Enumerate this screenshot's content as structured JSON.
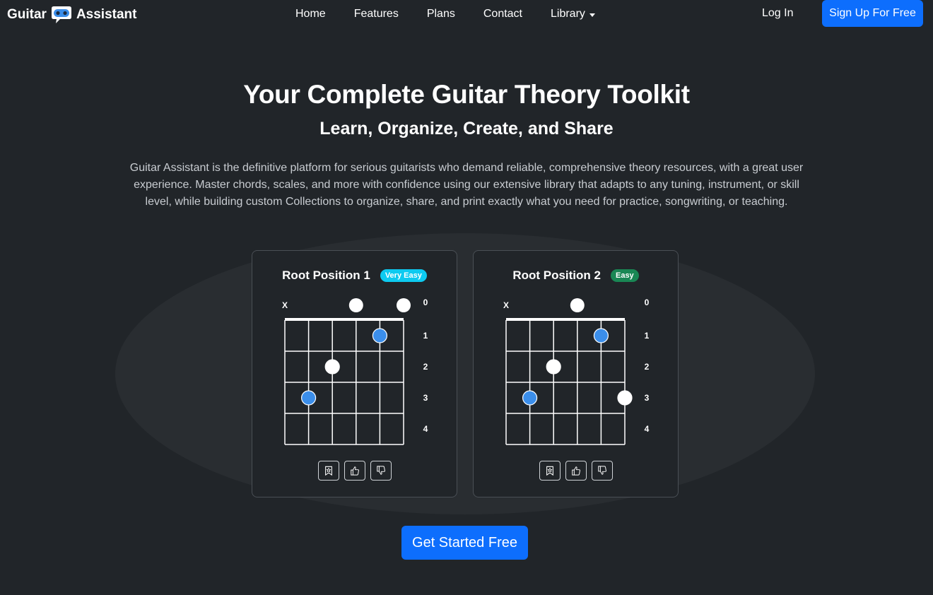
{
  "brand": {
    "word1": "Guitar",
    "word2": "Assistant",
    "logo_icon": "chat-bot-icon"
  },
  "nav": {
    "links": [
      "Home",
      "Features",
      "Plans",
      "Contact",
      "Library"
    ],
    "login": "Log In",
    "signup": "Sign Up For Free"
  },
  "hero": {
    "title": "Your Complete Guitar Theory Toolkit",
    "subtitle": "Learn, Organize, Create, and Share",
    "description": "Guitar Assistant is the definitive platform for serious guitarists who demand reliable, comprehensive theory resources, with a great user experience. Master chords, scales, and more with confidence using our extensive library that adapts to any tuning, instrument, or skill level, while building custom Collections to organize, share, and print exactly what you need for practice, songwriting, or teaching."
  },
  "colors": {
    "primary": "#0d6efd",
    "background": "#212529",
    "root_note": "#3b8eea",
    "badge_very_easy": "#0dcaf0",
    "badge_easy": "#198754"
  },
  "cards": [
    {
      "title": "Root Position 1",
      "badge": "Very Easy",
      "badge_color": "#0dcaf0",
      "fret_labels": [
        "0",
        "1",
        "2",
        "3",
        "4"
      ],
      "muted_label": "X",
      "strings": [
        {
          "string": 6,
          "state": "muted"
        },
        {
          "string": 5,
          "fret": 3,
          "root": true
        },
        {
          "string": 4,
          "fret": 2,
          "root": false
        },
        {
          "string": 3,
          "fret": 0,
          "root": false
        },
        {
          "string": 2,
          "fret": 1,
          "root": true
        },
        {
          "string": 1,
          "fret": 0,
          "root": false
        }
      ],
      "actions": [
        "bookmark-icon",
        "thumbs-up-icon",
        "thumbs-down-icon"
      ]
    },
    {
      "title": "Root Position 2",
      "badge": "Easy",
      "badge_color": "#198754",
      "fret_labels": [
        "0",
        "1",
        "2",
        "3",
        "4"
      ],
      "muted_label": "X",
      "strings": [
        {
          "string": 6,
          "state": "muted"
        },
        {
          "string": 5,
          "fret": 3,
          "root": true
        },
        {
          "string": 4,
          "fret": 2,
          "root": false
        },
        {
          "string": 3,
          "fret": 0,
          "root": false
        },
        {
          "string": 2,
          "fret": 1,
          "root": true
        },
        {
          "string": 1,
          "fret": 3,
          "root": false
        }
      ],
      "actions": [
        "bookmark-icon",
        "thumbs-up-icon",
        "thumbs-down-icon"
      ]
    }
  ],
  "cta": "Get Started Free"
}
